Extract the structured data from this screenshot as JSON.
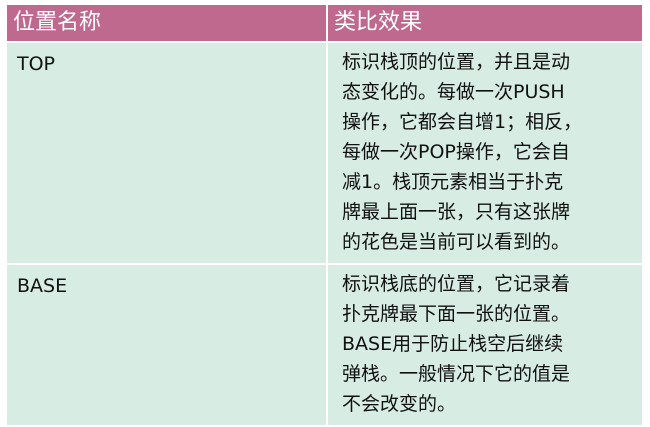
{
  "table": {
    "headers": {
      "name": "位置名称",
      "effect": "类比效果"
    },
    "rows": [
      {
        "name": "TOP",
        "description": "标识栈顶的位置，并且是动\n态变化的。每做一次PUSH\n操作，它都会自增1；相反，\n每做一次POP操作，它会自\n减1。栈顶元素相当于扑克\n牌最上面一张，只有这张牌\n的花色是当前可以看到的。"
      },
      {
        "name": "BASE",
        "description": "标识栈底的位置，它记录着\n扑克牌最下面一张的位置。\nBASE用于防止栈空后继续\n弹栈。一般情况下它的值是\n不会改变的。"
      }
    ]
  },
  "colors": {
    "header_bg": "#c0698f",
    "row_bg": "#d7ece3"
  }
}
